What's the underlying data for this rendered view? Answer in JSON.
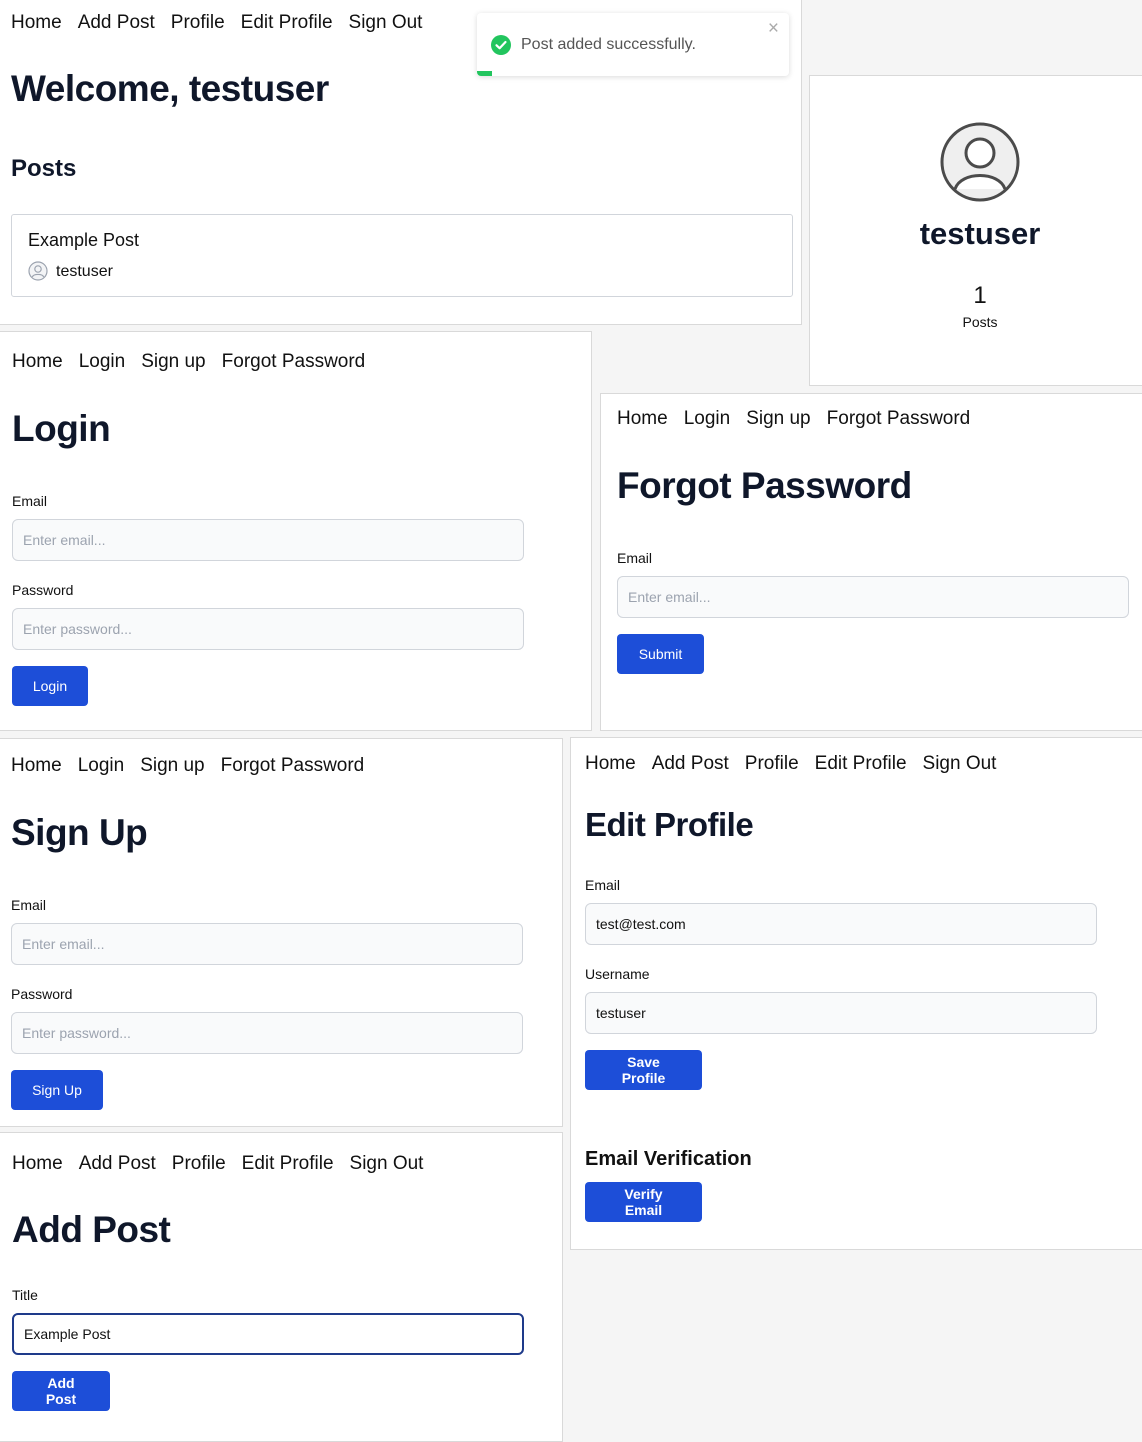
{
  "nav_auth": [
    "Home",
    "Add Post",
    "Profile",
    "Edit Profile",
    "Sign Out"
  ],
  "nav_guest": [
    "Home",
    "Login",
    "Sign up",
    "Forgot Password"
  ],
  "home": {
    "title": "Welcome, testuser",
    "posts_heading": "Posts",
    "post": {
      "title": "Example Post",
      "author": "testuser"
    }
  },
  "toast": {
    "message": "Post added successfully.",
    "close": "×"
  },
  "profile_card": {
    "username": "testuser",
    "post_count": "1",
    "post_label": "Posts"
  },
  "login": {
    "title": "Login",
    "email_label": "Email",
    "email_placeholder": "Enter email...",
    "password_label": "Password",
    "password_placeholder": "Enter password...",
    "button": "Login"
  },
  "forgot": {
    "title": "Forgot Password",
    "email_label": "Email",
    "email_placeholder": "Enter email...",
    "button": "Submit"
  },
  "signup": {
    "title": "Sign Up",
    "email_label": "Email",
    "email_placeholder": "Enter email...",
    "password_label": "Password",
    "password_placeholder": "Enter password...",
    "button": "Sign Up"
  },
  "edit_profile": {
    "title": "Edit Profile",
    "email_label": "Email",
    "email_value": "test@test.com",
    "username_label": "Username",
    "username_value": "testuser",
    "save_button": "Save Profile",
    "verification_heading": "Email Verification",
    "verify_button": "Verify Email"
  },
  "add_post": {
    "title": "Add Post",
    "title_label": "Title",
    "title_value": "Example Post",
    "button": "Add Post"
  },
  "colors": {
    "primary": "#1d4ed8",
    "success": "#22c55e",
    "heading": "#0f172a"
  }
}
